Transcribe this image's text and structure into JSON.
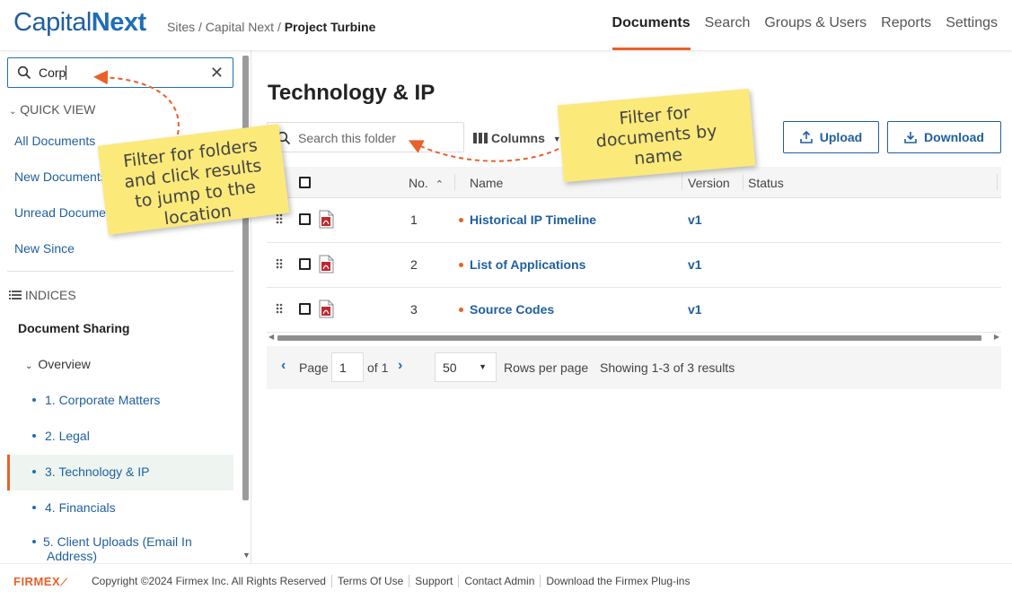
{
  "header": {
    "logo_part1": "Capital",
    "logo_part2": "Next",
    "breadcrumb_prefix": "Sites / Capital Next / ",
    "breadcrumb_current": "Project Turbine",
    "nav": [
      "Documents",
      "Search",
      "Groups & Users",
      "Reports",
      "Settings"
    ],
    "active_nav": "Documents"
  },
  "sidebar": {
    "search_value": "Corp",
    "quick_view_label": "QUICK VIEW",
    "quick_view_items": [
      "All Documents",
      "New Documents",
      "Unread Documents",
      "New Since"
    ],
    "indices_label": "INDICES",
    "root": "Document Sharing",
    "overview": "Overview",
    "folders": [
      "1. Corporate Matters",
      "2. Legal",
      "3. Technology & IP",
      "4. Financials",
      "5. Client Uploads (Email In Address)"
    ],
    "active_folder": "3. Technology & IP"
  },
  "main": {
    "title": "Technology & IP",
    "folder_search_placeholder": "Search this folder",
    "columns_label": "Columns",
    "upload_label": "Upload",
    "download_label": "Download",
    "table": {
      "headers": {
        "no": "No.",
        "name": "Name",
        "version": "Version",
        "status": "Status"
      },
      "rows": [
        {
          "no": "1",
          "name": "Historical IP Timeline",
          "version": "v1",
          "status": ""
        },
        {
          "no": "2",
          "name": "List of Applications",
          "version": "v1",
          "status": ""
        },
        {
          "no": "3",
          "name": "Source Codes",
          "version": "v1",
          "status": ""
        }
      ]
    },
    "pager": {
      "page_label": "Page",
      "page_value": "1",
      "of_label": "of 1",
      "rows_value": "50",
      "rows_label": "Rows per page",
      "showing": "Showing 1-3 of 3 results"
    }
  },
  "footer": {
    "brand": "FIRMEX",
    "links": [
      "Copyright ©2024 Firmex Inc. All Rights Reserved",
      "Terms Of Use",
      "Support",
      "Contact Admin",
      "Download the Firmex Plug-ins"
    ]
  },
  "callouts": {
    "left": "Filter for folders and click results to jump to the location",
    "right": "Filter for documents by name"
  },
  "colors": {
    "accent": "#e8612a",
    "brand_blue": "#1f5f9e",
    "note_yellow": "#fbe97a"
  }
}
